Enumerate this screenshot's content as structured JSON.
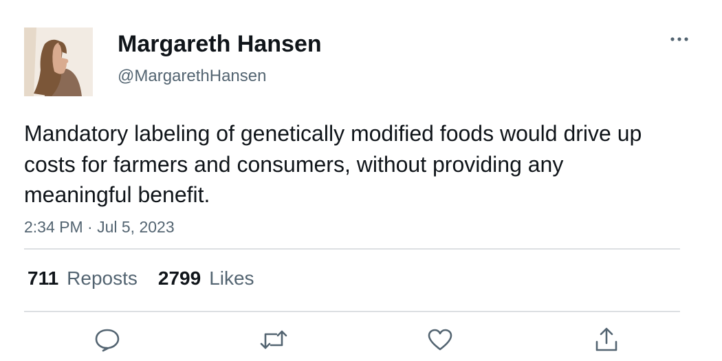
{
  "author": {
    "display_name": "Margareth Hansen",
    "handle": "@MargarethHansen",
    "avatar_icon": "profile-photo"
  },
  "tweet": {
    "text": "Mandatory labeling of genetically modified foods would drive up costs for farmers and consumers, without providing any meaningful benefit.",
    "timestamp": "2:34 PM · Jul 5, 2023"
  },
  "stats": {
    "reposts_count": "711",
    "reposts_label": "Reposts",
    "likes_count": "2799",
    "likes_label": "Likes"
  },
  "actions": {
    "reply_icon": "reply-icon",
    "repost_icon": "repost-icon",
    "like_icon": "heart-icon",
    "share_icon": "share-icon"
  },
  "colors": {
    "text_primary": "#0f1419",
    "text_secondary": "#536471",
    "divider": "#dcdfe2"
  }
}
